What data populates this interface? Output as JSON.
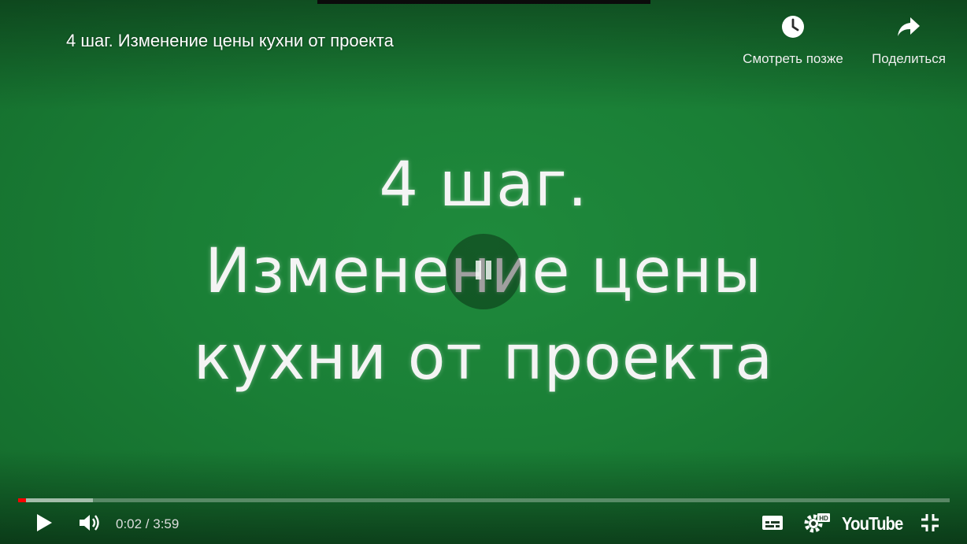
{
  "video": {
    "title": "4 шаг. Изменение цены кухни от проекта",
    "slide_lines": [
      "4 шаг.",
      "Изменение цены",
      "кухни от проекта"
    ]
  },
  "top_actions": {
    "watch_later_label": "Смотреть позже",
    "watch_later_icon": "clock-icon",
    "share_label": "Поделиться",
    "share_icon": "share-arrow-icon"
  },
  "player": {
    "time_display": "0:02 / 3:59",
    "progress_fraction": 0.0084,
    "loaded_fraction": 0.08,
    "accent_color": "#ff0000",
    "background_color": "#1a7f36",
    "logo_text": "YouTube"
  },
  "controls": {
    "left": [
      "play-icon",
      "volume-icon"
    ],
    "right": [
      "subtitles-icon",
      "settings-hd-icon",
      "youtube-logo",
      "exit-fullscreen-icon"
    ]
  }
}
